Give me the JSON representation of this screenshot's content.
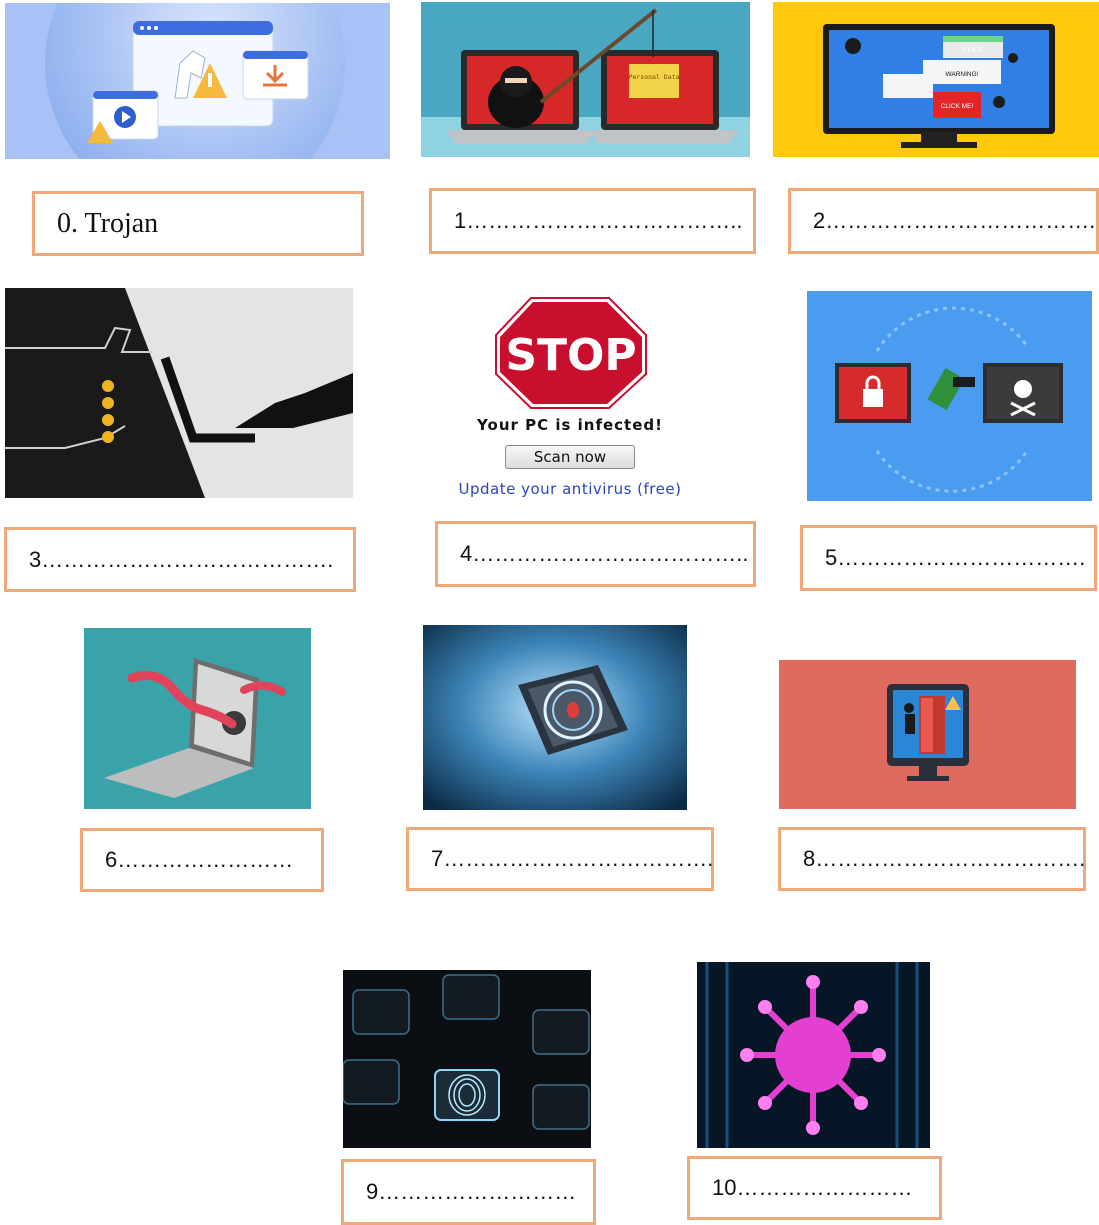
{
  "colors": {
    "box_border": "#f0a878",
    "stop_red": "#c8102e",
    "link_blue": "#2a44c6"
  },
  "stop_popup": {
    "sign_text": "STOP",
    "caption": "Your PC is infected!",
    "button_label": "Scan now",
    "link_text": "Update your antivirus (free)"
  },
  "image_labels": {
    "click": "CLICK",
    "warning": "WARNING!",
    "click_me": "CLICK ME!",
    "personal_data": "Personal Data"
  },
  "answer_boxes": [
    {
      "label": "0. Trojan"
    },
    {
      "label": "1……………………………….."
    },
    {
      "label": "2………………………………."
    },
    {
      "label": "3…………………………………."
    },
    {
      "label": "4……………………………….."
    },
    {
      "label": "5……………………………."
    },
    {
      "label": "6……………………"
    },
    {
      "label": "7………………………………."
    },
    {
      "label": "8………………………………."
    },
    {
      "label": "9………………………"
    },
    {
      "label": "10……………………"
    }
  ]
}
